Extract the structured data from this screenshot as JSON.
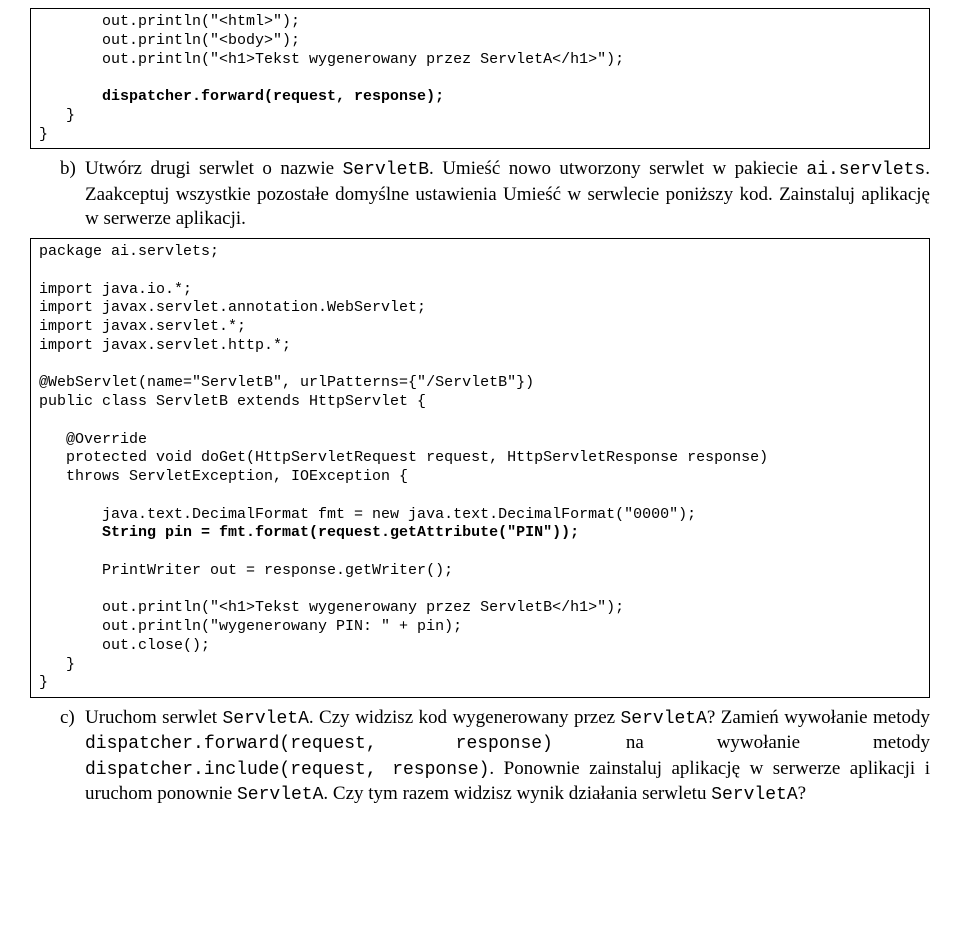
{
  "box1": {
    "l1": "       out.println(\"<html>\");",
    "l2": "       out.println(\"<body>\");",
    "l3": "       out.println(\"<h1>Tekst wygenerowany przez ServletA</h1>\");",
    "l4": "",
    "l5": "       dispatcher.forward(request, response);",
    "l6": "   }",
    "l7": "}"
  },
  "itemB": {
    "marker": "b)",
    "t1": "Utwórz drugi serwlet o nazwie ",
    "c1": "ServletB",
    "t2": ". Umieść nowo utworzony serwlet w pakiecie ",
    "c2": "ai.servlets",
    "t3": ". Zaakceptuj wszystkie pozostałe domyślne ustawienia Umieść w serwlecie poniższy kod. Zainstaluj aplikację w serwerze aplikacji."
  },
  "box2": {
    "l1": "package ai.servlets;",
    "l2": "",
    "l3": "import java.io.*;",
    "l4": "import javax.servlet.annotation.WebServlet;",
    "l5": "import javax.servlet.*;",
    "l6": "import javax.servlet.http.*;",
    "l7": "",
    "l8": "@WebServlet(name=\"ServletB\", urlPatterns={\"/ServletB\"})",
    "l9": "public class ServletB extends HttpServlet {",
    "l10": "",
    "l11": "   @Override",
    "l12": "   protected void doGet(HttpServletRequest request, HttpServletResponse response)",
    "l13": "   throws ServletException, IOException {",
    "l14": "",
    "l15": "       java.text.DecimalFormat fmt = new java.text.DecimalFormat(\"0000\");",
    "l16": "       String pin = fmt.format(request.getAttribute(\"PIN\"));",
    "l17": "",
    "l18": "       PrintWriter out = response.getWriter();",
    "l19": "",
    "l20": "       out.println(\"<h1>Tekst wygenerowany przez ServletB</h1>\");",
    "l21": "       out.println(\"wygenerowany PIN: \" + pin);",
    "l22": "       out.close();",
    "l23": "   }",
    "l24": "}"
  },
  "itemC": {
    "marker": "c)",
    "t1": "Uruchom serwlet ",
    "c1": "ServletA",
    "t2": ". Czy widzisz kod wygenerowany przez ",
    "c2": "ServletA",
    "t3": "? Zamień wywołanie metody ",
    "c3": "dispatcher.forward(request, response)",
    "t4": " na wywołanie metody ",
    "c4": "dispatcher.include(request, response)",
    "t5": ". Ponownie zainstaluj aplikację w serwerze aplikacji i uruchom ponownie ",
    "c5": "ServletA",
    "t6": ". Czy tym razem widzisz wynik działania serwletu ",
    "c6": "ServletA",
    "t7": "?"
  }
}
